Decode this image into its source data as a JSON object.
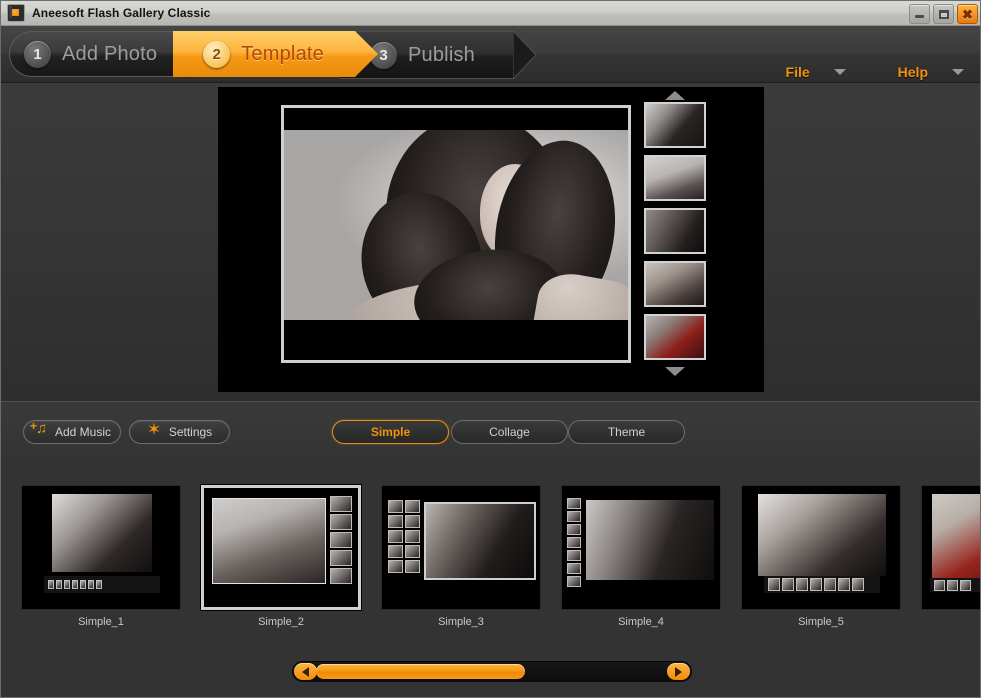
{
  "window": {
    "title": "Aneesoft Flash Gallery Classic",
    "app_icon": "app-logo-icon",
    "controls": {
      "minimize": "minimize-icon",
      "maximize": "maximize-icon",
      "close": "✖"
    }
  },
  "steps": [
    {
      "number": "1",
      "label": "Add Photo",
      "active": false
    },
    {
      "number": "2",
      "label": "Template",
      "active": true
    },
    {
      "number": "3",
      "label": "Publish",
      "active": false
    }
  ],
  "menus": [
    {
      "label": "File",
      "caret": "chevron-down-icon"
    },
    {
      "label": "Help",
      "caret": "chevron-down-icon"
    }
  ],
  "preview": {
    "filmstrip": {
      "up_arrow": "scroll-up-icon",
      "down_arrow": "scroll-down-icon",
      "thumbs": [
        {
          "name": "preview-thumb-1"
        },
        {
          "name": "preview-thumb-2"
        },
        {
          "name": "preview-thumb-3"
        },
        {
          "name": "preview-thumb-4"
        },
        {
          "name": "preview-thumb-5"
        }
      ]
    }
  },
  "toolbar": {
    "add_music_label": "Add Music",
    "add_music_icon": "music-note-plus-icon",
    "settings_label": "Settings",
    "settings_icon": "tools-icon",
    "tabs": [
      {
        "label": "Simple",
        "selected": true
      },
      {
        "label": "Collage",
        "selected": false
      },
      {
        "label": "Theme",
        "selected": false
      }
    ]
  },
  "gallery": {
    "templates": [
      {
        "label": "Simple_1",
        "selected": false
      },
      {
        "label": "Simple_2",
        "selected": true
      },
      {
        "label": "Simple_3",
        "selected": false
      },
      {
        "label": "Simple_4",
        "selected": false
      },
      {
        "label": "Simple_5",
        "selected": false
      },
      {
        "label": "",
        "selected": false
      }
    ]
  },
  "scrollbar": {
    "left_arrow": "scroll-left-icon",
    "right_arrow": "scroll-right-icon",
    "thumb_position_percent": 0,
    "thumb_size_percent": 55
  },
  "colors": {
    "accent_orange": "#f0920e",
    "accent_orange_bright": "#ffb33e",
    "panel_dark": "#333333",
    "stage_black": "#000000",
    "text_light": "#cfcfcf"
  }
}
